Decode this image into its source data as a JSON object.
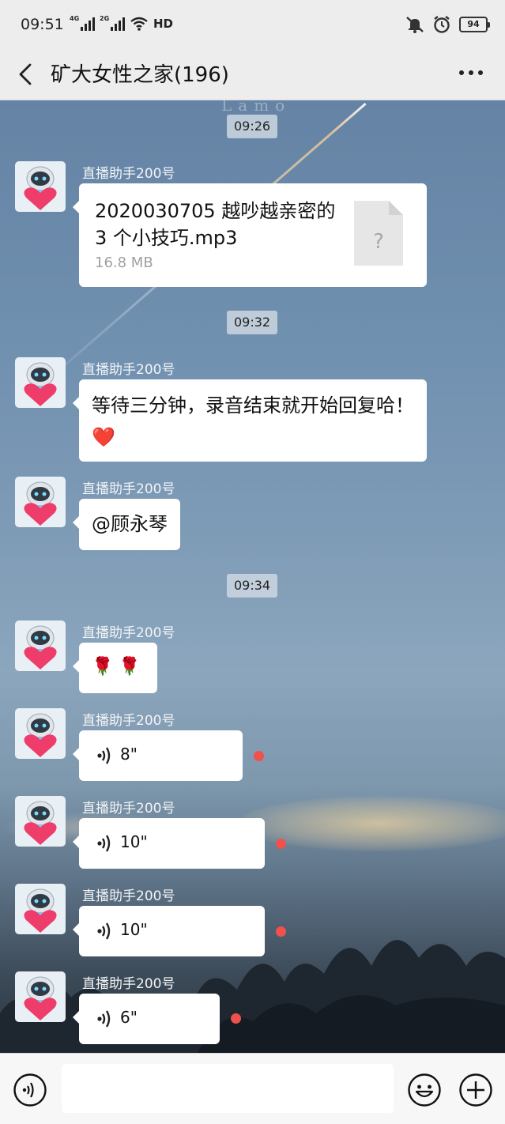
{
  "status": {
    "time": "09:51",
    "net1": "4G",
    "net2": "2G",
    "hd": "HD",
    "battery": "94"
  },
  "header": {
    "title": "矿大女性之家(196)"
  },
  "chat": {
    "watermark": "Lamo",
    "timestamps": [
      "09:26",
      "09:32",
      "09:34"
    ],
    "sender": "直播助手200号",
    "file": {
      "name": "2020030705 越吵越亲密的 3 个小技巧.mp3",
      "size": "16.8 MB",
      "icon": "?"
    },
    "text1": "等待三分钟，录音结束就开始回复哈！",
    "text1_emoji": "❤️",
    "text2": "@顾永琴",
    "text3": "🌹 🌹",
    "voices": [
      {
        "duration": "8\""
      },
      {
        "duration": "10\""
      },
      {
        "duration": "10\""
      },
      {
        "duration": "6\""
      }
    ]
  },
  "inputbar": {
    "placeholder": ""
  },
  "icons": {
    "back": "chevron-left-icon",
    "more": "more-dots-icon",
    "voice": "voice-input-icon",
    "emoji": "emoji-icon",
    "plus": "plus-icon"
  },
  "colors": {
    "bubble": "#ffffff",
    "unread_dot": "#f0514d",
    "heart": "#f26322"
  }
}
